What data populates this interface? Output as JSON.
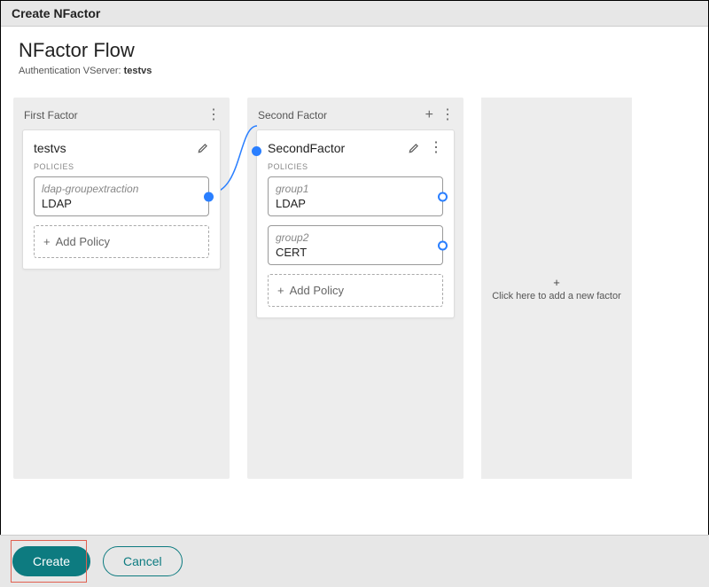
{
  "titlebar": "Create NFactor",
  "header": {
    "title": "NFactor Flow",
    "sub_label": "Authentication VServer: ",
    "sub_value": "testvs"
  },
  "columns": [
    {
      "title": "First Factor",
      "show_plus": false,
      "card": {
        "name": "testvs",
        "show_more": false,
        "policies_label": "POLICIES",
        "policies": [
          {
            "name": "ldap-groupextraction",
            "type": "LDAP",
            "connector": "out-solid"
          }
        ],
        "add_label": "Add Policy"
      }
    },
    {
      "title": "Second Factor",
      "show_plus": true,
      "card": {
        "name": "SecondFactor",
        "show_more": true,
        "policies_label": "POLICIES",
        "policies": [
          {
            "name": "group1",
            "type": "LDAP",
            "connector": "out-hollow"
          },
          {
            "name": "group2",
            "type": "CERT",
            "connector": "out-hollow"
          }
        ],
        "add_label": "Add Policy"
      }
    }
  ],
  "add_factor": {
    "label": "Click here to add a new factor"
  },
  "footer": {
    "create": "Create",
    "cancel": "Cancel"
  }
}
